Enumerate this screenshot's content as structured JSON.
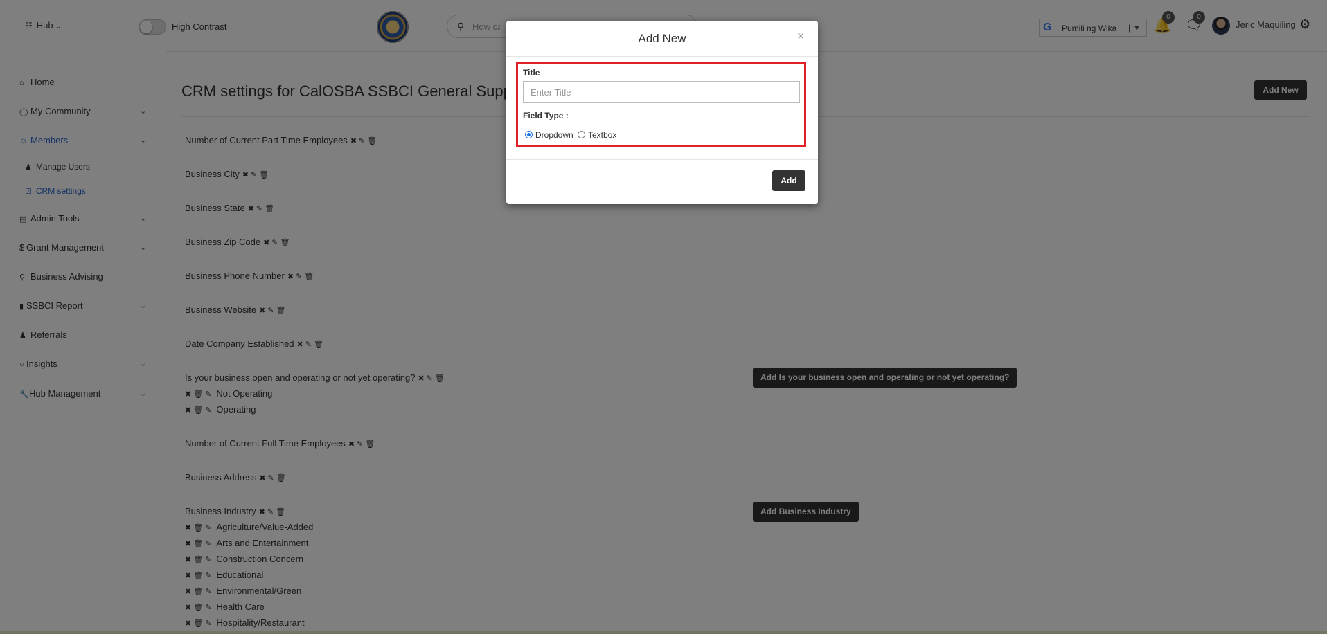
{
  "header": {
    "hub_label": "Hub",
    "high_contrast_label": "High Contrast",
    "search_placeholder": "How can",
    "translate_label": "Pumili ng Wika",
    "notifications_count": "0",
    "messages_count": "0",
    "user_name": "Jeric Maquiling"
  },
  "sidebar": {
    "items": [
      {
        "label": "Home",
        "icon": "home-icon"
      },
      {
        "label": "My Community",
        "icon": "community-icon"
      },
      {
        "label": "Members",
        "icon": "user-circle-icon"
      },
      {
        "label": "Manage Users",
        "icon": "users-icon"
      },
      {
        "label": "CRM settings",
        "icon": "check-square-icon"
      },
      {
        "label": "Admin Tools",
        "icon": "table-icon"
      },
      {
        "label": "Grant Management",
        "icon": "dollar-icon"
      },
      {
        "label": "Business Advising",
        "icon": "key-icon"
      },
      {
        "label": "SSBCI Report",
        "icon": "file-icon"
      },
      {
        "label": "Referrals",
        "icon": "user-plus-icon"
      },
      {
        "label": "Insights",
        "icon": "lightbulb-icon"
      },
      {
        "label": "Hub Management",
        "icon": "wrench-icon"
      }
    ]
  },
  "main": {
    "page_title": "CRM settings for CalOSBA SSBCI General Suppo",
    "add_new_label": "Add New",
    "fields": [
      "Number of Current Part Time Employees",
      "Business City",
      "Business State",
      "Business Zip Code",
      "Business Phone Number",
      "Business Website",
      "Date Company Established",
      "Is your business open and operating or not yet operating?",
      "Number of Current Full Time Employees",
      "Business Address",
      "Business Industry"
    ],
    "operating_options": [
      "Not Operating",
      "Operating"
    ],
    "industry_options": [
      "Agriculture/Value-Added",
      "Arts and Entertainment",
      "Construction Concern",
      "Educational",
      "Environmental/Green",
      "Health Care",
      "Hospitality/Restaurant"
    ],
    "add_operating_label": "Add Is your business open and operating or not yet operating?",
    "add_industry_label": "Add Business Industry"
  },
  "modal": {
    "title": "Add New",
    "close_label": "×",
    "title_label": "Title",
    "title_placeholder": "Enter Title",
    "field_type_label": "Field Type :",
    "radio_dropdown": "Dropdown",
    "radio_textbox": "Textbox",
    "selected_type": "Dropdown",
    "add_label": "Add"
  },
  "colors": {
    "highlight_box": "#e11f26",
    "button_dark": "#333333",
    "active_link": "#2a62c9"
  }
}
